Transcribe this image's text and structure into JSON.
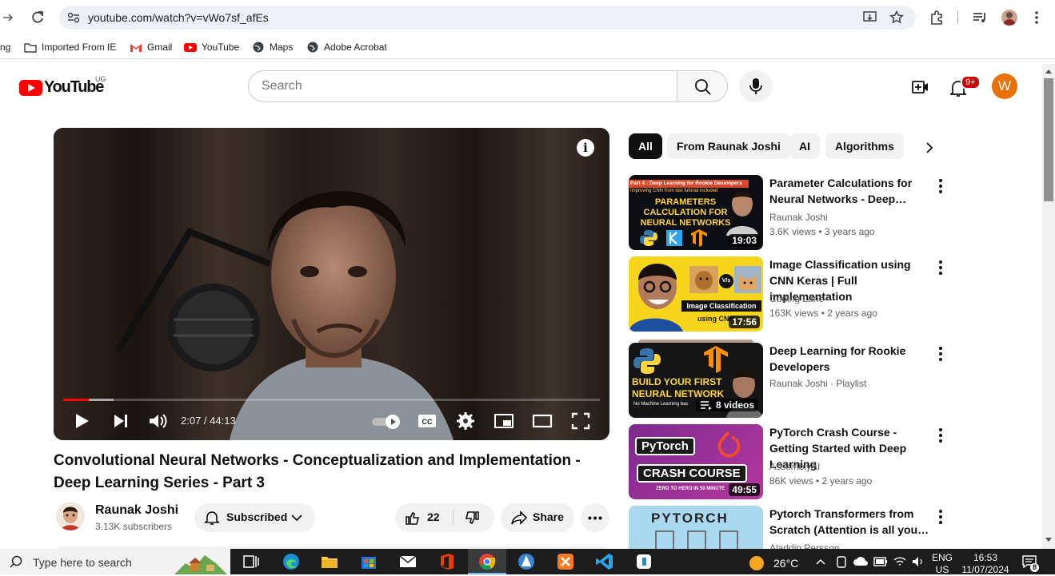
{
  "browser": {
    "url": "youtube.com/watch?v=vWo7sf_afEs",
    "bookmarks": [
      "ng",
      "Imported From IE",
      "Gmail",
      "YouTube",
      "Maps",
      "Adobe Acrobat"
    ]
  },
  "header": {
    "logo_text": "YouTube",
    "country": "UG",
    "search_placeholder": "Search",
    "notification_count": "9+",
    "avatar_letter": "W"
  },
  "player": {
    "time": "2:07 / 44:13",
    "progress_fraction": 0.048,
    "buffered_fraction": 0.094
  },
  "video": {
    "title": "Convolutional Neural Networks - Conceptualization and Implementation - Deep Learning Series - Part 3",
    "channel": "Raunak Joshi",
    "subscribers": "3.13K subscribers",
    "subscribed_label": "Subscribed",
    "likes": "22",
    "share_label": "Share"
  },
  "chips": [
    "All",
    "From Raunak Joshi",
    "AI",
    "Algorithms"
  ],
  "recommendations": [
    {
      "title": "Parameter Calculations for Neural Networks - Deep…",
      "channel": "Raunak Joshi",
      "meta": "3.6K views • 3 years ago",
      "duration": "19:03",
      "thumb_banner": "Part 4 : Deep Learning for Rookie Developers",
      "thumb_sub": "Improving CNN from last tutorial included",
      "thumb_text": "PARAMETERS CALCULATION FOR NEURAL NETWORKS"
    },
    {
      "title": "Image Classification using CNN Keras | Full implementation",
      "channel": "Coding Lane",
      "meta": "163K views • 2 years ago",
      "duration": "17:56",
      "thumb_text": "Image Classification",
      "thumb_sub": "using CNN",
      "thumb_vs": "V/s"
    },
    {
      "title": "Deep Learning for Rookie Developers",
      "channel": "Raunak Joshi · Playlist",
      "meta": "",
      "duration": "8 videos",
      "thumb_text": "BUILD YOUR FIRST NEURAL NETWORK",
      "thumb_sub": "No Machine Learning bas"
    },
    {
      "title": "PyTorch Crash Course - Getting Started with Deep Learning",
      "channel": "AssemblyAI",
      "meta": "86K views • 2 years ago",
      "duration": "49:55",
      "thumb_text": "PyTorch",
      "thumb_sub": "CRASH COURSE",
      "thumb_small": "ZERO TO HERO IN 50 MINUTE"
    },
    {
      "title": "Pytorch Transformers from Scratch (Attention is all you…",
      "channel": "Aladdin Persson",
      "meta": "",
      "duration": "",
      "thumb_text": "PYTORCH"
    }
  ],
  "taskbar": {
    "search_placeholder": "Type here to search",
    "weather": "26°C",
    "lang_top": "ENG",
    "lang_bottom": "US",
    "clock_time": "16:53",
    "clock_date": "11/07/2024",
    "notif_count": "8"
  },
  "colors": {
    "yt_red": "#ff0000",
    "avatar_orange": "#e8710a",
    "taskbar": "#1c1c1c"
  }
}
